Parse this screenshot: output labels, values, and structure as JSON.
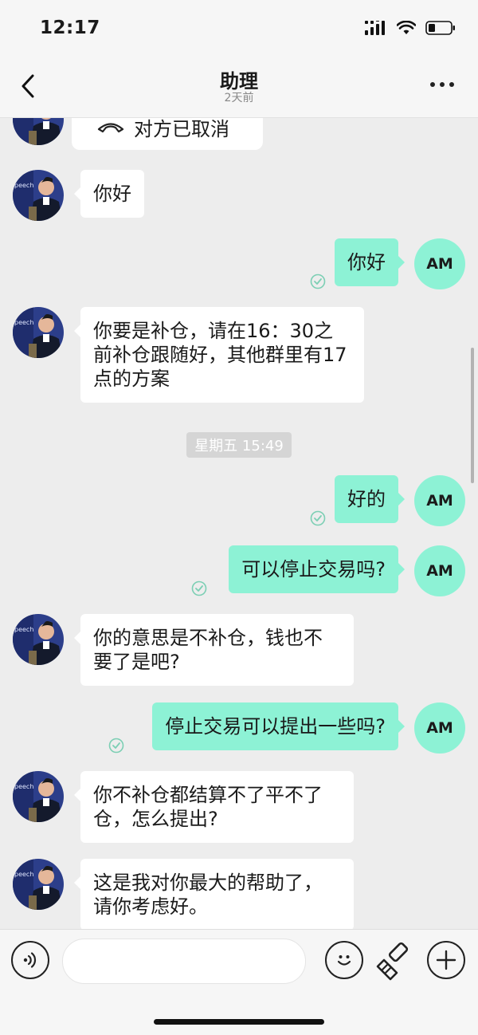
{
  "status_bar": {
    "time": "12:17"
  },
  "header": {
    "title": "助理",
    "subtitle": "2天前"
  },
  "call_card": {
    "text": "对方已取消"
  },
  "time_divider": "星期五 15:49",
  "messages": [
    {
      "side": "left",
      "text": "你好"
    },
    {
      "side": "right",
      "text": "你好"
    },
    {
      "side": "left",
      "text": "你要是补仓，请在16：30之前补仓跟随好，其他群里有17点的方案"
    },
    {
      "side": "right",
      "text": "好的"
    },
    {
      "side": "right",
      "text": "可以停止交易吗?"
    },
    {
      "side": "left",
      "text": "你的意思是不补仓，钱也不要了是吧?"
    },
    {
      "side": "right",
      "text": "停止交易可以提出一些吗?"
    },
    {
      "side": "left",
      "text": "你不补仓都结算不了平不了仓，怎么提出?"
    },
    {
      "side": "left",
      "text": "这是我对你最大的帮助了，请你考虑好。"
    }
  ],
  "self_avatar_initials": "AM",
  "contact_avatar_caption": "peech",
  "colors": {
    "accent": "#8df2d5",
    "check": "#7ccfb4",
    "background": "#ededed"
  },
  "input_bar": {
    "placeholder": "",
    "icons": [
      "voice-icon",
      "emoji-icon",
      "brush-icon",
      "plus-icon"
    ]
  }
}
